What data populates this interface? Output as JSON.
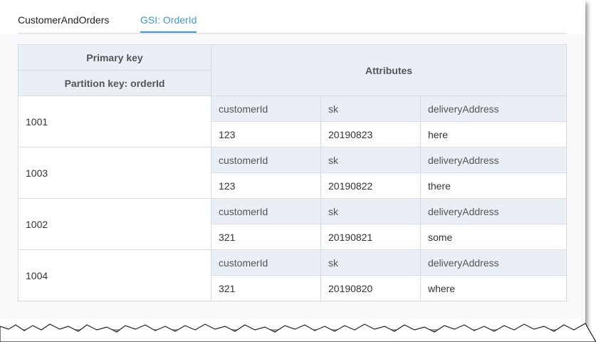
{
  "tabs": [
    {
      "label": "CustomerAndOrders",
      "active": false
    },
    {
      "label": "GSI: OrderId",
      "active": true
    }
  ],
  "table": {
    "header_primary": "Primary key",
    "header_partition": "Partition key: orderId",
    "header_attributes": "Attributes",
    "rows": [
      {
        "key": "1001",
        "attr_names": [
          "customerId",
          "sk",
          "deliveryAddress"
        ],
        "attr_values": [
          "123",
          "20190823",
          "here"
        ]
      },
      {
        "key": "1003",
        "attr_names": [
          "customerId",
          "sk",
          "deliveryAddress"
        ],
        "attr_values": [
          "123",
          "20190822",
          "there"
        ]
      },
      {
        "key": "1002",
        "attr_names": [
          "customerId",
          "sk",
          "deliveryAddress"
        ],
        "attr_values": [
          "321",
          "20190821",
          "some"
        ]
      },
      {
        "key": "1004",
        "attr_names": [
          "customerId",
          "sk",
          "deliveryAddress"
        ],
        "attr_values": [
          "321",
          "20190820",
          "where"
        ]
      }
    ]
  },
  "colors": {
    "accent": "#3d9ad1",
    "header_bg": "#eaeef5",
    "border": "#d8dbe3"
  }
}
